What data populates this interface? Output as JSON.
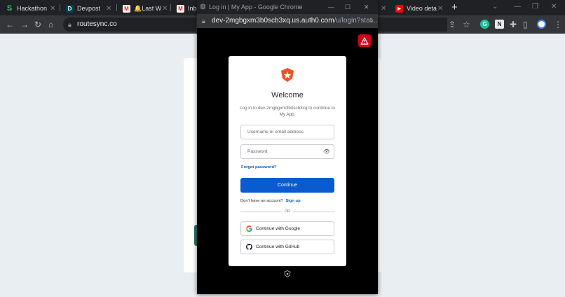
{
  "browser": {
    "tabs": [
      {
        "label": "Hackathon",
        "fav": "S",
        "fav_bg": "#202124",
        "fav_color": "#2ecc71"
      },
      {
        "label": "Devpost",
        "fav": "D",
        "fav_bg": "#003e54",
        "fav_color": "#ffffff"
      },
      {
        "label": "🔔Last W",
        "fav": "M",
        "fav_bg": "#ffffff",
        "fav_color": "#d93025"
      },
      {
        "label": "Inbo",
        "fav": "M",
        "fav_bg": "#ffffff",
        "fav_color": "#d93025"
      },
      {
        "label": "Video deta",
        "fav": "▶",
        "fav_bg": "#ff0000",
        "fav_color": "#ffffff"
      }
    ],
    "tab_close": "✕",
    "new_tab": "+",
    "url": "routesync.co",
    "icons": {
      "back": "arrow-left-icon",
      "forward": "arrow-right-icon",
      "reload": "reload-icon",
      "home": "home-icon",
      "lock": "lock-icon",
      "share": "share-icon",
      "bookmark": "star-icon",
      "extensions": "puzzle-icon",
      "profile": "profile-icon",
      "menu": "menu-icon"
    }
  },
  "popup": {
    "window_title": "Log in | My App - Google Chrome",
    "url_host": "dev-2mgbgxm3b0scb3xq.us.auth0.com",
    "url_path": "/u/login?stat...",
    "warning_icon": "warning-icon"
  },
  "login": {
    "heading": "Welcome",
    "subtitle": "Log in to dev-2mgbgxm3b0scb3xq to continue to My App.",
    "username_placeholder": "Username or email address",
    "password_placeholder": "Password",
    "forgot_password": "Forgot password?",
    "continue_label": "Continue",
    "no_account_text": "Don't have an account?",
    "sign_up": "Sign up",
    "or_text": "OR",
    "google_label": "Continue with Google",
    "github_label": "Continue with GitHub",
    "accent_color": "#0a5bcf",
    "logo_color": "#eb5424"
  }
}
